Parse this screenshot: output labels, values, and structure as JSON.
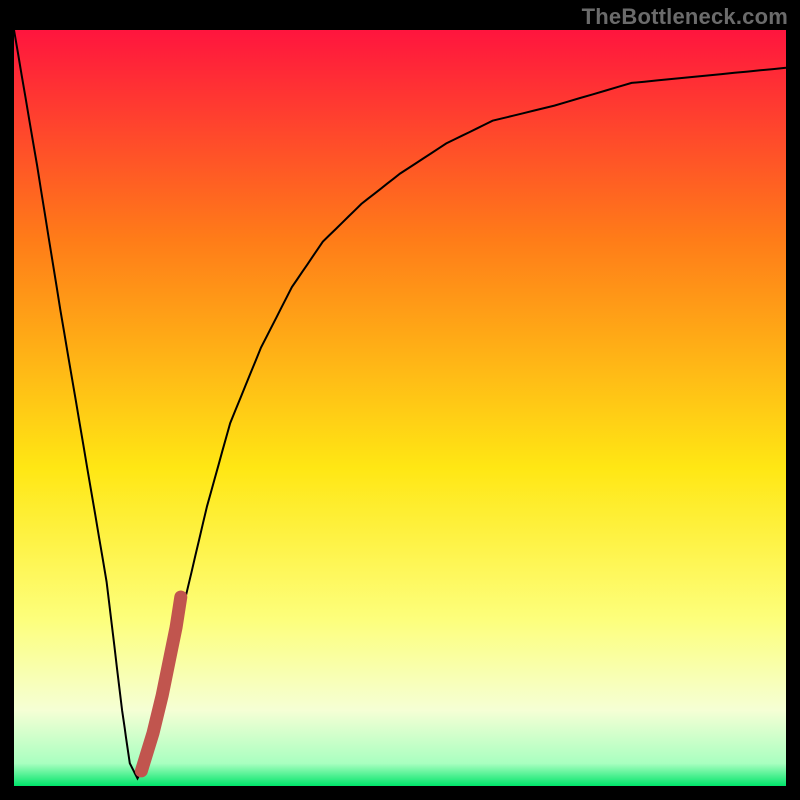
{
  "watermark": "TheBottleneck.com",
  "colors": {
    "frame": "#000000",
    "gradient_top": "#ff153e",
    "gradient_mid_top": "#ff7d18",
    "gradient_mid": "#ffe714",
    "gradient_low": "#fdff7c",
    "gradient_pale": "#f5ffd5",
    "gradient_bottom": "#00e46a",
    "curve": "#000000",
    "marker": "#c1554e"
  },
  "chart_data": {
    "type": "line",
    "title": "",
    "xlabel": "",
    "ylabel": "",
    "xlim": [
      0,
      100
    ],
    "ylim": [
      0,
      100
    ],
    "series": [
      {
        "name": "bottleneck-curve",
        "x": [
          0,
          3,
          6,
          9,
          12,
          14,
          15,
          16,
          17,
          19,
          22,
          25,
          28,
          32,
          36,
          40,
          45,
          50,
          56,
          62,
          70,
          80,
          90,
          100
        ],
        "y": [
          100,
          82,
          63,
          45,
          27,
          10,
          3,
          1,
          3,
          10,
          24,
          37,
          48,
          58,
          66,
          72,
          77,
          81,
          85,
          88,
          90,
          93,
          94,
          95
        ]
      }
    ],
    "markers": [
      {
        "name": "highlight-segment",
        "x": [
          16.5,
          18.0,
          19.2,
          20.2,
          21.0,
          21.6
        ],
        "y": [
          2,
          7,
          12,
          17,
          21,
          25
        ]
      }
    ],
    "gradient_stops": [
      {
        "pct": 0,
        "color": "#ff153e"
      },
      {
        "pct": 28,
        "color": "#ff7d18"
      },
      {
        "pct": 58,
        "color": "#ffe714"
      },
      {
        "pct": 78,
        "color": "#fdff7c"
      },
      {
        "pct": 90,
        "color": "#f5ffd5"
      },
      {
        "pct": 97,
        "color": "#a9ffc0"
      },
      {
        "pct": 100,
        "color": "#00e46a"
      }
    ]
  }
}
